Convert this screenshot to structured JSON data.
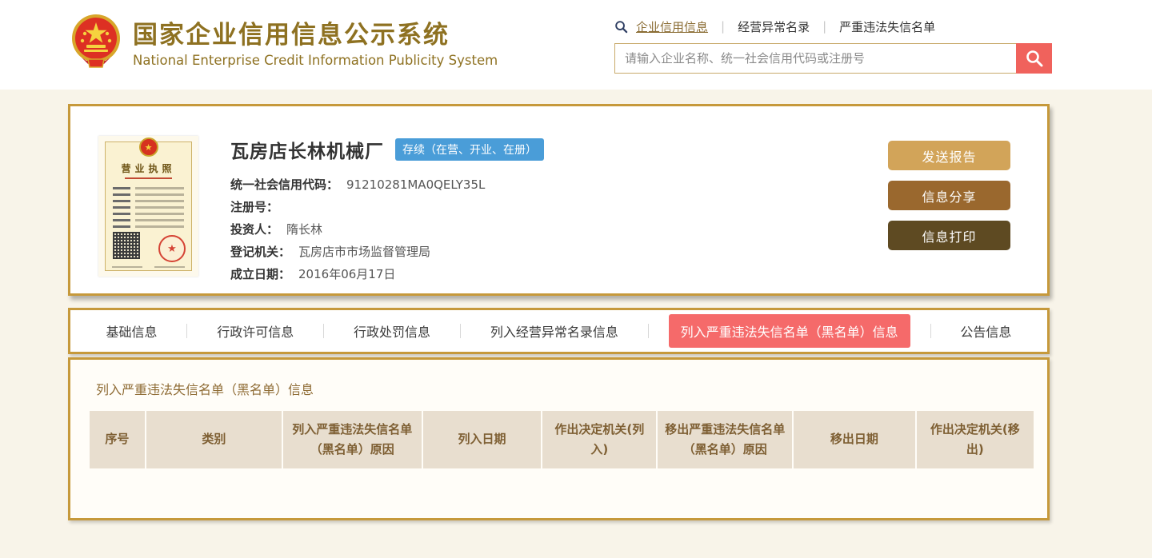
{
  "header": {
    "title": "国家企业信用信息公示系统",
    "subtitle": "National Enterprise Credit Information Publicity System",
    "nav_links": [
      {
        "label": "企业信用信息",
        "active": true
      },
      {
        "label": "经营异常名录",
        "active": false
      },
      {
        "label": "严重违法失信名单",
        "active": false
      }
    ],
    "search": {
      "placeholder": "请输入企业名称、统一社会信用代码或注册号"
    }
  },
  "company": {
    "name": "瓦房店长林机械厂",
    "status_badge": "存续（在营、开业、在册）",
    "license_title": "营业执照",
    "fields": [
      {
        "label": "统一社会信用代码：",
        "value": "91210281MA0QELY35L"
      },
      {
        "label": "注册号：",
        "value": ""
      },
      {
        "label": "投资人：",
        "value": "隋长林"
      },
      {
        "label": "登记机关：",
        "value": "瓦房店市市场监督管理局"
      },
      {
        "label": "成立日期：",
        "value": "2016年06月17日"
      }
    ],
    "actions": [
      {
        "label": "发送报告",
        "color": "#d2a459"
      },
      {
        "label": "信息分享",
        "color": "#9a682e"
      },
      {
        "label": "信息打印",
        "color": "#5e4a22"
      }
    ]
  },
  "tabs": [
    {
      "label": "基础信息",
      "active": false
    },
    {
      "label": "行政许可信息",
      "active": false
    },
    {
      "label": "行政处罚信息",
      "active": false
    },
    {
      "label": "列入经营异常名录信息",
      "active": false
    },
    {
      "label": "列入严重违法失信名单（黑名单）信息",
      "active": true
    },
    {
      "label": "公告信息",
      "active": false
    }
  ],
  "section": {
    "title": "列入严重违法失信名单（黑名单）信息",
    "table": {
      "headers": [
        "序号",
        "类别",
        "列入严重违法失信名单（黑名单）原因",
        "列入日期",
        "作出决定机关(列入)",
        "移出严重违法失信名单（黑名单）原因",
        "移出日期",
        "作出决定机关(移出)"
      ],
      "rows": []
    }
  },
  "colors": {
    "gold_border": "#c6993b",
    "title_gold": "#8e7121",
    "active_tab_red": "#f56a6a",
    "search_button_red": "#f0625c",
    "status_badge_blue": "#4a9dd8",
    "table_header_bg": "#e8decf",
    "page_background": "#f8f4e9"
  }
}
